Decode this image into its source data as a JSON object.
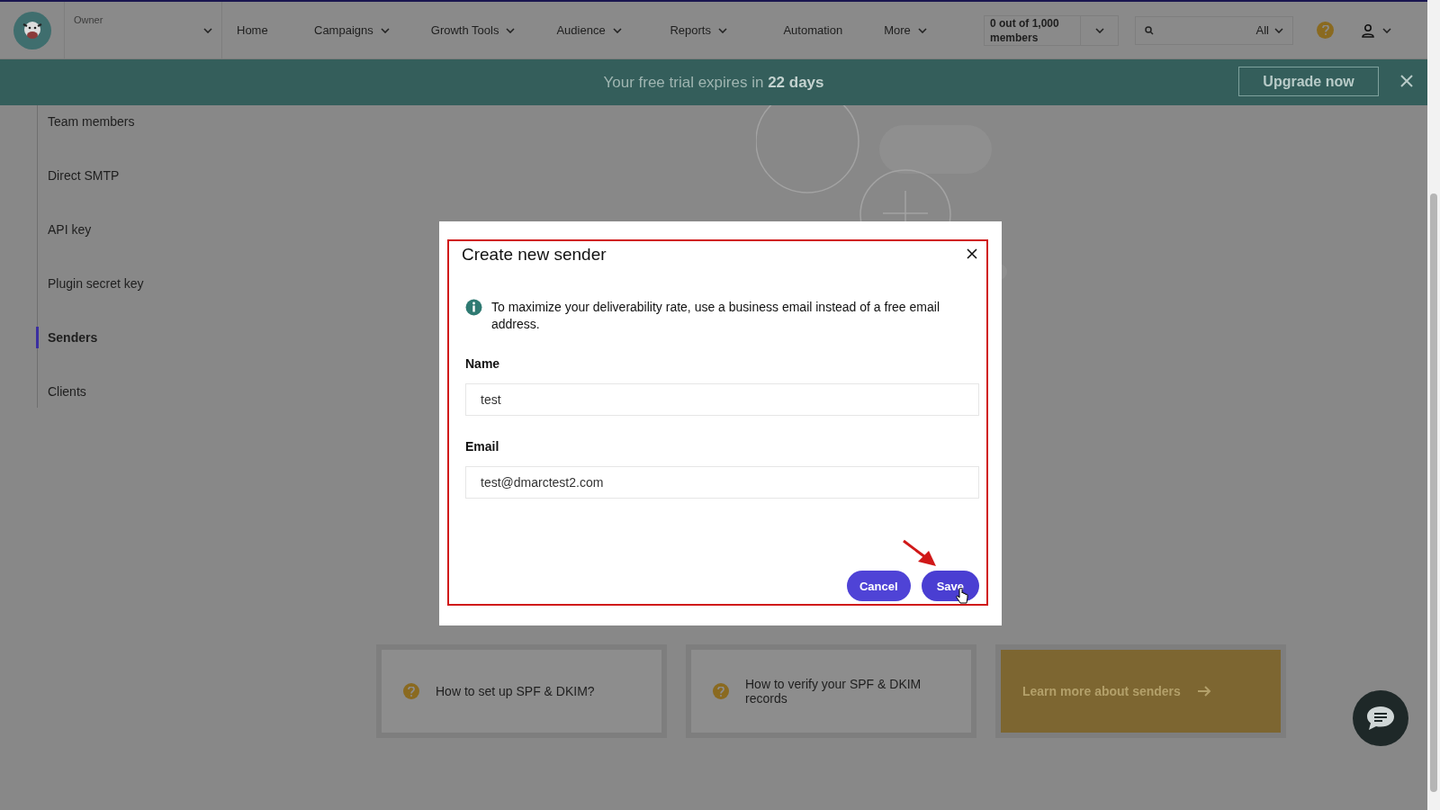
{
  "account": {
    "label": "Owner"
  },
  "nav": [
    {
      "label": "Home",
      "dropdown": false
    },
    {
      "label": "Campaigns",
      "dropdown": true
    },
    {
      "label": "Growth Tools",
      "dropdown": true
    },
    {
      "label": "Audience",
      "dropdown": true
    },
    {
      "label": "Reports",
      "dropdown": true
    },
    {
      "label": "Automation",
      "dropdown": false
    },
    {
      "label": "More",
      "dropdown": true
    }
  ],
  "members": {
    "text": "0 out of 1,000 members"
  },
  "search": {
    "filter": "All"
  },
  "banner": {
    "text": "Your free trial expires in **22 days**",
    "button": "Upgrade now"
  },
  "sidebar": {
    "items": [
      {
        "label": "Team members",
        "selected": false
      },
      {
        "label": "Direct SMTP",
        "selected": false
      },
      {
        "label": "API key",
        "selected": false
      },
      {
        "label": "Plugin secret key",
        "selected": false
      },
      {
        "label": "Senders",
        "selected": true
      },
      {
        "label": "Clients",
        "selected": false
      }
    ]
  },
  "help_cards": [
    {
      "kind": "question",
      "text": "How to set up SPF & DKIM?"
    },
    {
      "kind": "question",
      "text": "How to verify your SPF & DKIM records"
    },
    {
      "kind": "cta",
      "text": "Learn more about senders"
    }
  ],
  "dialog": {
    "title": "Create new sender",
    "notice": "To maximize your deliverability rate, use a business email instead of a free email address.",
    "fields": [
      {
        "label": "Name",
        "value": "test"
      },
      {
        "label": "Email",
        "value": "test@dmarctest2.com"
      }
    ],
    "buttons": [
      {
        "label": "Cancel",
        "kind": "secondary"
      },
      {
        "label": "Save",
        "kind": "primary"
      }
    ]
  }
}
